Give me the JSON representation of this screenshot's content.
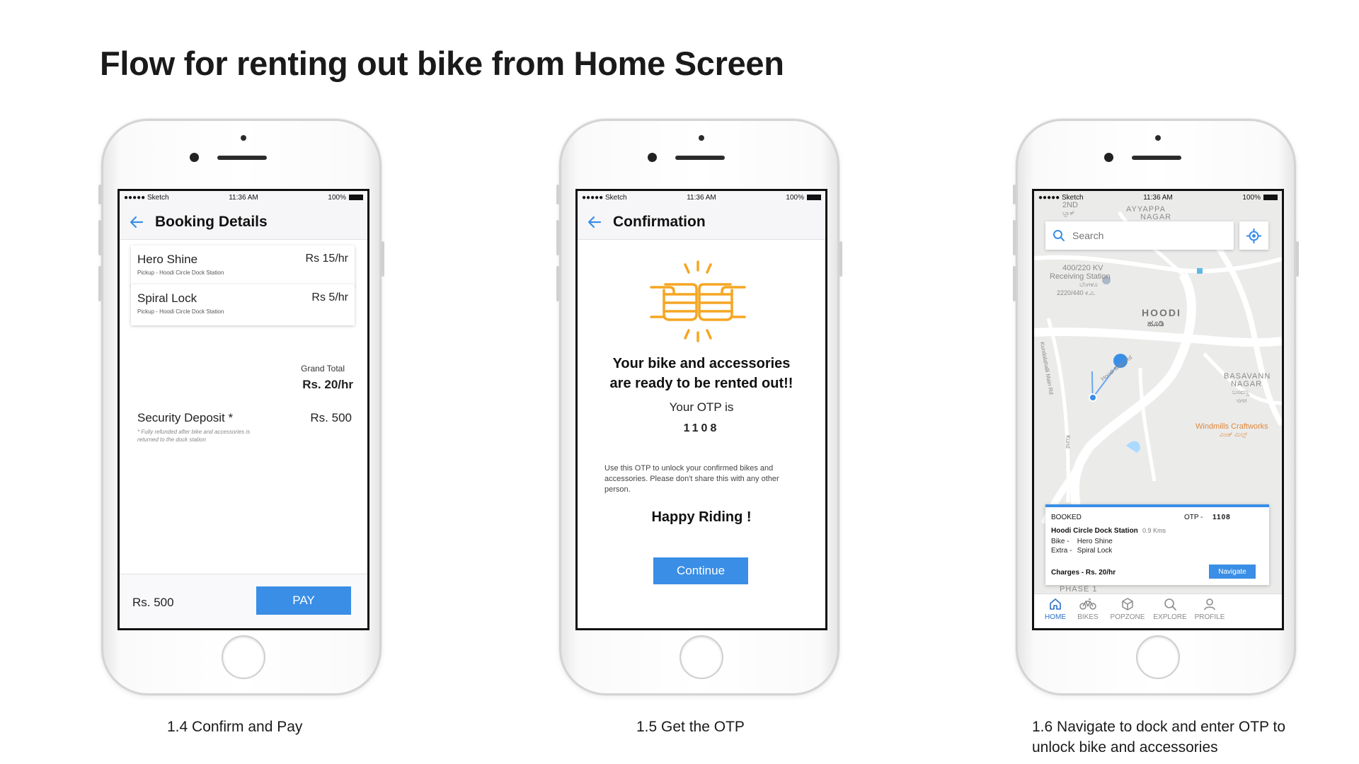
{
  "title": "Flow for renting out bike from Home Screen",
  "status_bar": {
    "carrier": "●●●●● Sketch",
    "time": "11:36 AM",
    "battery": "100%"
  },
  "screens": {
    "booking": {
      "title": "Booking Details",
      "items": [
        {
          "name": "Hero Shine",
          "pickup": "Pickup - Hoodi Circle Dock Station",
          "price": "Rs 15/hr"
        },
        {
          "name": "Spiral Lock",
          "pickup": "Pickup - Hoodi Circle Dock Station",
          "price": "Rs 5/hr"
        }
      ],
      "grand_total_label": "Grand Total",
      "grand_total_value": "Rs. 20/hr",
      "deposit_label": "Security Deposit *",
      "deposit_note": "* Fully refunded after bike and accessories is returned to the dock station",
      "deposit_value": "Rs. 500",
      "footer_amount": "Rs. 500",
      "pay_label": "PAY"
    },
    "confirmation": {
      "title": "Confirmation",
      "heading": "Your bike and accessories are ready to be rented out!!",
      "otp_label": "Your OTP is",
      "otp_value": "1108",
      "note": "Use this OTP to unlock your confirmed bikes and accessories. Please don't share this with any other person.",
      "happy": "Happy Riding !",
      "continue_label": "Continue"
    },
    "home": {
      "search_placeholder": "Search",
      "map_labels": {
        "area_2nd": "2ND",
        "ayyappa": "AYYAPPA",
        "nagar": "NAGAR",
        "kannada_1": "ಬ್ಲಾಕ್",
        "receiving": "400/220 KV",
        "receiving2": "Receiving Station",
        "kannada_2": "ಬೆಂಗಳೂ",
        "kv2": "2220/440 ಕ.ವಿ.",
        "hoodi": "HOODI",
        "hoodi_kn": "ಹೂಡಿ",
        "basavanna": "BASAVANN",
        "basavanna2": "NAGAR",
        "basavanna_kn": "ಬಸವಣ್ಣ",
        "basavanna_kn2": "ನಗರ",
        "windmills": "Windmills Craftworks",
        "windmills_kn": "ವಿಂಡ್ ಮಿಲ್ಸ್",
        "road": "Hoodi Main Rd",
        "road2": "Kundalahalli Main Rd",
        "road3": "Kund",
        "phase": "PHASE 1"
      },
      "booked": {
        "status": "BOOKED",
        "otp_label": "OTP -",
        "otp_value": "1108",
        "station": "Hoodi Circle Dock Station",
        "distance": "0.9 Kms",
        "bike_label": "Bike -",
        "bike_value": "Hero Shine",
        "extra_label": "Extra -",
        "extra_value": "Spiral Lock",
        "charges": "Charges - Rs. 20/hr",
        "navigate_label": "Navigate"
      },
      "tabs": [
        "HOME",
        "BIKES",
        "POPZONE",
        "EXPLORE",
        "PROFILE"
      ]
    }
  },
  "captions": [
    "1.4 Confirm and Pay",
    "1.5 Get the OTP",
    "1.6 Navigate to dock and enter OTP to",
    "unlock bike and accessories"
  ],
  "colors": {
    "accent": "#3a8ee6",
    "icon_orange": "#f5a623",
    "tab_active": "#2e6fc5"
  }
}
